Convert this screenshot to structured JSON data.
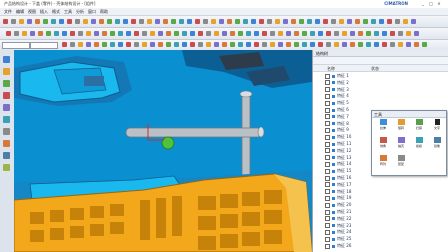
{
  "titlebar": {
    "title": "产品结构设计 - 下盖 (零件) - 壳体结构设计 - [组件]",
    "brand": "CIMATRON",
    "min": "_",
    "max": "□",
    "close": "×"
  },
  "menubar": {
    "items": [
      "文件",
      "编辑",
      "视图",
      "插入",
      "格式",
      "工具",
      "分析",
      "窗口",
      "帮助"
    ]
  },
  "toolbar": {
    "search_placeholder": "",
    "zoom_value": "100%"
  },
  "panel": {
    "title": "结构树",
    "col_name": "名称",
    "col_value": "状态",
    "rows": [
      "特征 1",
      "特征 2",
      "特征 3",
      "特征 4",
      "特征 5",
      "特征 6",
      "特征 7",
      "特征 8",
      "特征 9",
      "特征 10",
      "特征 11",
      "特征 12",
      "特征 13",
      "特征 14",
      "特征 15",
      "特征 16",
      "特征 17",
      "特征 18",
      "特征 19",
      "特征 20",
      "特征 21",
      "特征 22",
      "特征 23",
      "特征 24",
      "特征 25",
      "特征 26"
    ]
  },
  "dialog": {
    "title": "工具",
    "buttons": [
      "拉伸",
      "旋转",
      "扫掠",
      "文字",
      "倒角",
      "抽壳",
      "拔模",
      "镜像",
      "阵列",
      "装配"
    ]
  },
  "colors": {
    "viewport_bg": "#0a8fd1",
    "part_orange": "#f3a81b",
    "part_blue": "#19b8ee",
    "rod_gray": "#b9c0c6"
  }
}
